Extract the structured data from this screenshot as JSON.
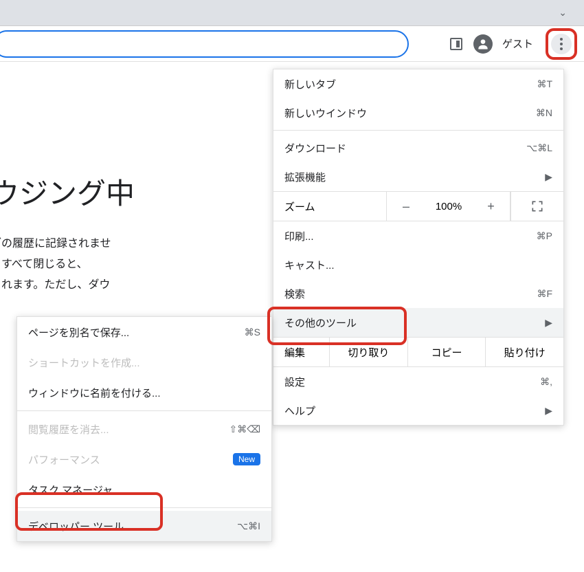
{
  "toolbar": {
    "guest_label": "ゲスト"
  },
  "background": {
    "heading": "ウジング中",
    "line1": "ブの履歴に記録されませ",
    "line2": "をすべて閉じると、",
    "line3": "されます。ただし、ダウ"
  },
  "main_menu": {
    "new_tab": {
      "label": "新しいタブ",
      "shortcut": "⌘T"
    },
    "new_window": {
      "label": "新しいウインドウ",
      "shortcut": "⌘N"
    },
    "downloads": {
      "label": "ダウンロード",
      "shortcut": "⌥⌘L"
    },
    "extensions": {
      "label": "拡張機能"
    },
    "zoom": {
      "label": "ズーム",
      "value": "100%"
    },
    "print": {
      "label": "印刷...",
      "shortcut": "⌘P"
    },
    "cast": {
      "label": "キャスト..."
    },
    "find": {
      "label": "検索",
      "shortcut": "⌘F"
    },
    "more_tools": {
      "label": "その他のツール"
    },
    "edit": {
      "label": "編集",
      "cut": "切り取り",
      "copy": "コピー",
      "paste": "貼り付け"
    },
    "settings": {
      "label": "設定",
      "shortcut": "⌘,"
    },
    "help": {
      "label": "ヘルプ"
    }
  },
  "sub_menu": {
    "save_as": {
      "label": "ページを別名で保存...",
      "shortcut": "⌘S"
    },
    "create_shortcut": {
      "label": "ショートカットを作成..."
    },
    "name_window": {
      "label": "ウィンドウに名前を付ける..."
    },
    "clear_history": {
      "label": "閲覧履歴を消去...",
      "shortcut": "⇧⌘⌫"
    },
    "performance": {
      "label": "パフォーマンス",
      "badge": "New"
    },
    "task_manager": {
      "label": "タスク マネージャ"
    },
    "dev_tools": {
      "label": "デベロッパー ツール",
      "shortcut": "⌥⌘I"
    }
  }
}
